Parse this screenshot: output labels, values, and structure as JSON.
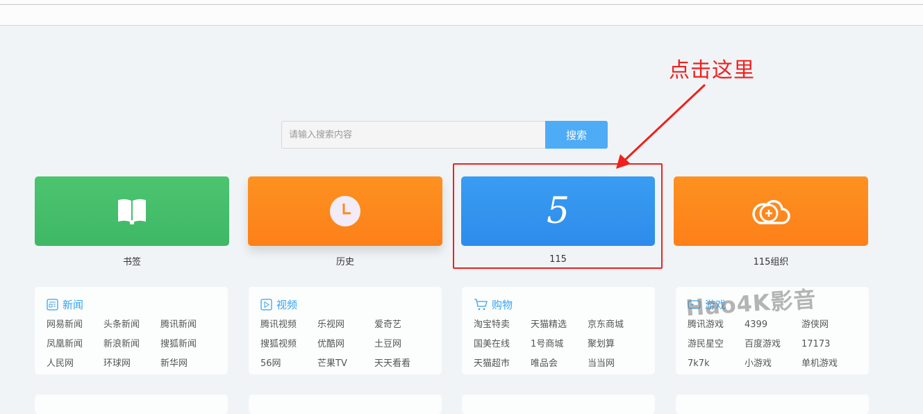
{
  "search": {
    "placeholder": "请输入搜索内容",
    "button": "搜索"
  },
  "tiles": [
    {
      "label": "书签",
      "icon": "book-icon",
      "color": "#45bf6b"
    },
    {
      "label": "历史",
      "icon": "clock-icon",
      "color": "#fd8a1c"
    },
    {
      "label": "115",
      "icon": "115-logo-icon",
      "glyph": "5",
      "color": "#3394ee"
    },
    {
      "label": "115组织",
      "icon": "cloud-plus-icon",
      "color": "#fd8a1c"
    }
  ],
  "annotation": {
    "text": "点击这里",
    "color": "#f0201c"
  },
  "cards": [
    {
      "title": "新闻",
      "icon": "news-icon",
      "links": [
        "网易新闻",
        "头条新闻",
        "腾讯新闻",
        "凤凰新闻",
        "新浪新闻",
        "搜狐新闻",
        "人民网",
        "环球网",
        "新华网"
      ]
    },
    {
      "title": "视频",
      "icon": "play-icon",
      "links": [
        "腾讯视频",
        "乐视网",
        "爱奇艺",
        "搜狐视频",
        "优酷网",
        "土豆网",
        "56网",
        "芒果TV",
        "天天看看"
      ]
    },
    {
      "title": "购物",
      "icon": "cart-icon",
      "links": [
        "淘宝特卖",
        "天猫精选",
        "京东商城",
        "国美在线",
        "1号商城",
        "聚划算",
        "天猫超市",
        "唯品会",
        "当当网"
      ]
    },
    {
      "title": "游戏",
      "icon": "gamepad-icon",
      "links": [
        "腾讯游戏",
        "4399",
        "游侠网",
        "游民星空",
        "百度游戏",
        "17173",
        "7k7k",
        "小游戏",
        "单机游戏"
      ]
    }
  ],
  "watermark": "Hao4K影音"
}
